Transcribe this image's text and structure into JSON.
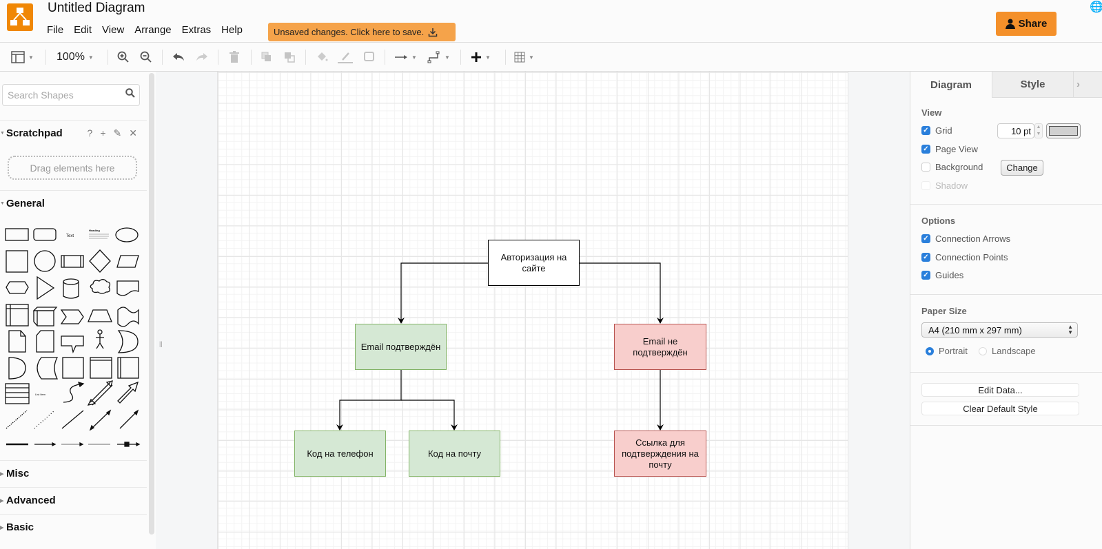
{
  "app": {
    "title": "Untitled Diagram",
    "menus": [
      "File",
      "Edit",
      "View",
      "Arrange",
      "Extras",
      "Help"
    ],
    "save_banner": "Unsaved changes. Click here to save.",
    "share_label": "Share",
    "brand_color": "#f08705"
  },
  "toolbar": {
    "zoom": "100%",
    "items": [
      "format-panel",
      "zoom-in",
      "zoom-out",
      "undo",
      "redo",
      "delete",
      "to-front",
      "to-back",
      "fill-color",
      "line-color",
      "shadow",
      "connection",
      "waypoints",
      "insert",
      "table"
    ]
  },
  "left_panel": {
    "search_placeholder": "Search Shapes",
    "scratchpad": {
      "label": "Scratchpad",
      "tools": [
        "?",
        "+",
        "✎",
        "✕"
      ],
      "drop_hint": "Drag elements here"
    },
    "sections": [
      "General",
      "Misc",
      "Advanced",
      "Basic"
    ],
    "shape_labels": {
      "text": "Text",
      "heading": "Heading",
      "list_item": "List Item",
      "list": "List"
    }
  },
  "diagram": {
    "nodes": [
      {
        "id": "auth",
        "label": "Авторизация на сайте",
        "style": "plain"
      },
      {
        "id": "email_ok",
        "label": "Email подтверждён",
        "style": "green"
      },
      {
        "id": "email_no",
        "label": "Email не подтверждён",
        "style": "red"
      },
      {
        "id": "code_phone",
        "label": "Код на телефон",
        "style": "green"
      },
      {
        "id": "code_mail",
        "label": "Код на почту",
        "style": "green"
      },
      {
        "id": "link_mail",
        "label": "Ссылка для подтверждения на почту",
        "style": "red"
      }
    ],
    "edges": [
      {
        "from": "auth",
        "to": "email_ok"
      },
      {
        "from": "auth",
        "to": "email_no"
      },
      {
        "from": "email_ok",
        "to": "code_phone"
      },
      {
        "from": "email_ok",
        "to": "code_mail"
      },
      {
        "from": "email_no",
        "to": "link_mail"
      }
    ],
    "colors": {
      "green_fill": "#d5e8d4",
      "green_stroke": "#82b366",
      "red_fill": "#f8cecc",
      "red_stroke": "#b85450"
    }
  },
  "right_panel": {
    "tabs": [
      "Diagram",
      "Style"
    ],
    "view": {
      "heading": "View",
      "grid": {
        "label": "Grid",
        "checked": true,
        "size": "10 pt"
      },
      "page_view": {
        "label": "Page View",
        "checked": true
      },
      "background": {
        "label": "Background",
        "checked": false,
        "button": "Change"
      },
      "shadow": {
        "label": "Shadow",
        "checked": false,
        "disabled": true
      }
    },
    "options": {
      "heading": "Options",
      "connection_arrows": {
        "label": "Connection Arrows",
        "checked": true
      },
      "connection_points": {
        "label": "Connection Points",
        "checked": true
      },
      "guides": {
        "label": "Guides",
        "checked": true
      }
    },
    "paper": {
      "heading": "Paper Size",
      "selected": "A4 (210 mm x 297 mm)",
      "portrait": "Portrait",
      "landscape": "Landscape",
      "orientation": "portrait"
    },
    "buttons": {
      "edit_data": "Edit Data...",
      "clear_style": "Clear Default Style"
    }
  }
}
